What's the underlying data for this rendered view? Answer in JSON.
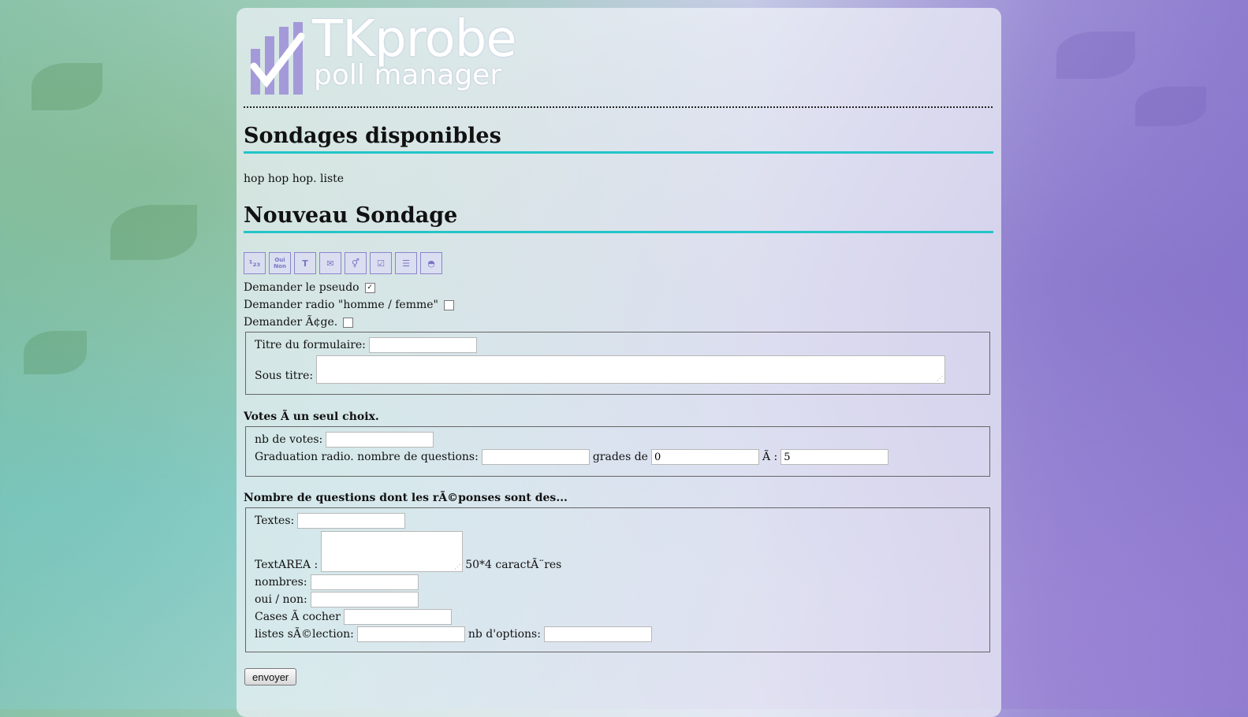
{
  "header": {
    "logo_title": "TKprobe",
    "logo_subtitle": "poll manager"
  },
  "available": {
    "heading": "Sondages disponibles",
    "text": "hop hop hop. liste"
  },
  "new_poll": {
    "heading": "Nouveau Sondage",
    "toolbar_icons": [
      "numbers-icon",
      "yes-no-icon",
      "text-icon",
      "envelope-icon",
      "gender-icon",
      "checkbox-icon",
      "list-icon",
      "cake-icon"
    ],
    "toolbar_glyphs": [
      "¹₂₃",
      "Oui Non",
      "T",
      "✉",
      "⚥",
      "☑",
      "☰",
      "◓"
    ],
    "options": [
      {
        "label": "Demander le pseudo",
        "checked": true
      },
      {
        "label": "Demander radio \"homme / femme\"",
        "checked": false
      },
      {
        "label": "Demander Ã¢ge.",
        "checked": false
      }
    ],
    "form_title_label": "Titre du formulaire:",
    "subtitle_label": "Sous titre:"
  },
  "single_choice": {
    "heading": "Votes Ã  un seul choix.",
    "nb_votes_label": "nb de votes:",
    "graduation_label": "Graduation radio. nombre de questions:",
    "grades_label": "grades de",
    "grades_from": "0",
    "to_label": "Ã :",
    "grades_to": "5"
  },
  "answers": {
    "heading": "Nombre de questions dont les rÃ©ponses sont des...",
    "texts_label": "Textes:",
    "textarea_label": "TextAREA :",
    "textarea_note": "50*4 caractÃ¨res",
    "numbers_label": "nombres:",
    "yes_no_label": "oui / non:",
    "checkboxes_label": "Cases Ã  cocher",
    "selection_label": "listes sÃ©lection:",
    "nb_options_label": "nb d'options:"
  },
  "submit_label": "envoyer"
}
